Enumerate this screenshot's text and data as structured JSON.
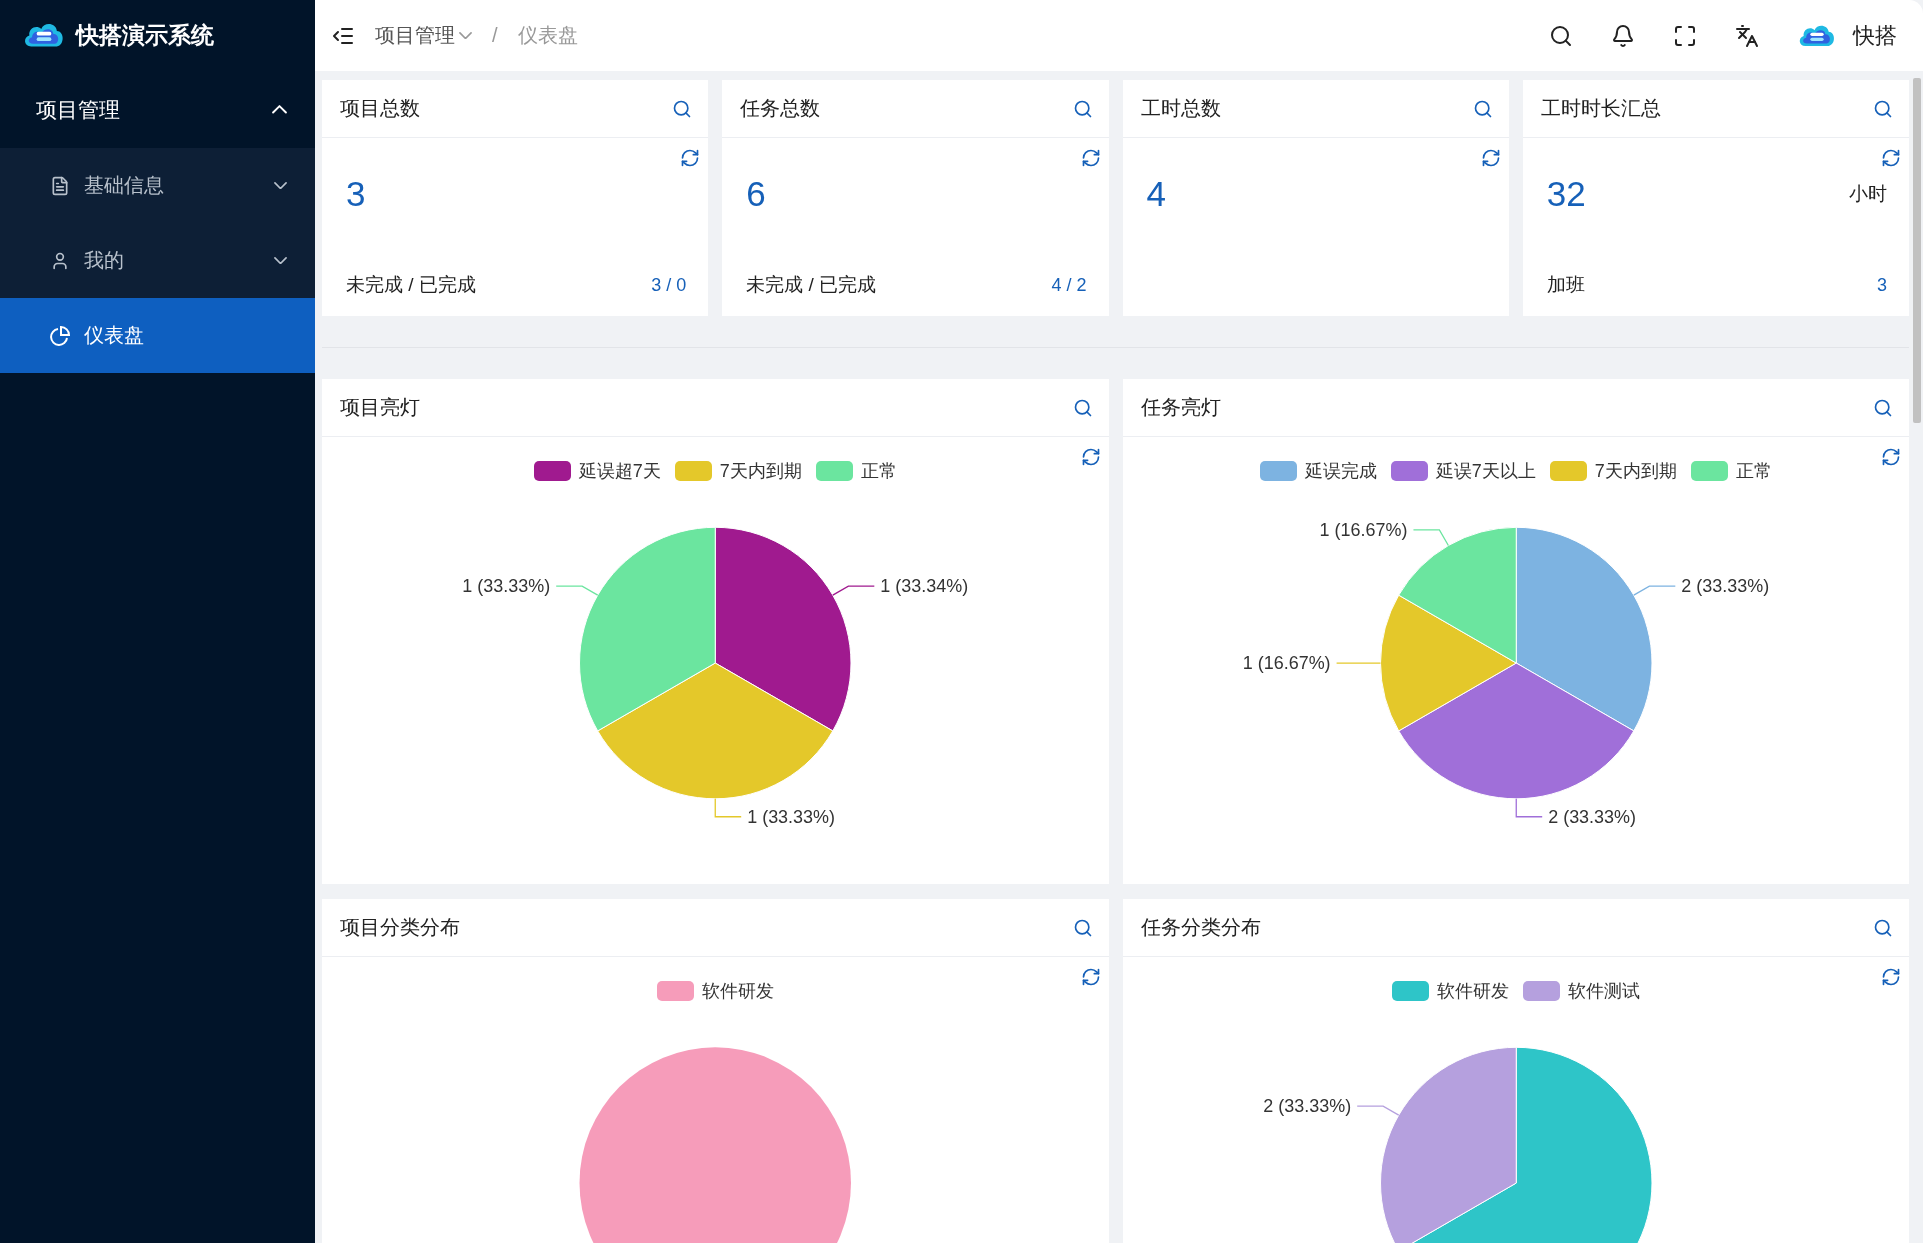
{
  "app": {
    "title": "快搭演示系统"
  },
  "sidebar": {
    "items": [
      {
        "label": "项目管理",
        "kind": "group",
        "expanded": true,
        "children": [
          {
            "label": "基础信息",
            "kind": "submenu",
            "expanded": false,
            "selected": false
          },
          {
            "label": "我的",
            "kind": "submenu",
            "expanded": false,
            "selected": false
          },
          {
            "label": "仪表盘",
            "kind": "item",
            "selected": true
          }
        ]
      }
    ]
  },
  "header": {
    "breadcrumb": [
      {
        "label": "项目管理",
        "kind": "menu"
      },
      {
        "label": "仪表盘",
        "kind": "page"
      }
    ],
    "separator": "/",
    "user": {
      "name": "快搭"
    }
  },
  "stats": [
    {
      "title": "项目总数",
      "value": "3",
      "footer_label": "未完成 / 已完成",
      "footer_value": "3 / 0"
    },
    {
      "title": "任务总数",
      "value": "6",
      "footer_label": "未完成 / 已完成",
      "footer_value": "4 / 2"
    },
    {
      "title": "工时总数",
      "value": "4"
    },
    {
      "title": "工时时长汇总",
      "value": "32",
      "unit": "小时",
      "footer_label": "加班",
      "footer_value": "3"
    }
  ],
  "charts": [
    {
      "title": "项目亮灯",
      "chart_data": {
        "type": "pie",
        "categories": [
          "延误超7天",
          "7天内到期",
          "正常"
        ],
        "colors": [
          "#a01a8f",
          "#e4c82a",
          "#6be59f"
        ],
        "values": [
          1,
          1,
          1
        ],
        "value_labels": [
          "1 (33.34%)",
          "1 (33.33%)",
          "1 (33.33%)"
        ]
      }
    },
    {
      "title": "任务亮灯",
      "chart_data": {
        "type": "pie",
        "categories": [
          "延误完成",
          "延误7天以上",
          "7天内到期",
          "正常"
        ],
        "colors": [
          "#7db3e1",
          "#a06fd9",
          "#e4c82a",
          "#6be59f"
        ],
        "values": [
          2,
          2,
          1,
          1
        ],
        "value_labels": [
          "2 (33.33%)",
          "2 (33.33%)",
          "1 (16.67%)",
          "1 (16.67%)"
        ]
      }
    },
    {
      "title": "项目分类分布",
      "chart_data": {
        "type": "pie",
        "categories": [
          "软件研发"
        ],
        "colors": [
          "#f69cba"
        ],
        "values": [
          100
        ],
        "value_labels": [
          null
        ]
      }
    },
    {
      "title": "任务分类分布",
      "chart_data": {
        "type": "pie",
        "categories": [
          "软件研发",
          "软件测试"
        ],
        "colors": [
          "#2ec5c8",
          "#b5a0de"
        ],
        "values": [
          4,
          2
        ],
        "value_labels": [
          null,
          "2 (33.33%)"
        ]
      }
    }
  ]
}
